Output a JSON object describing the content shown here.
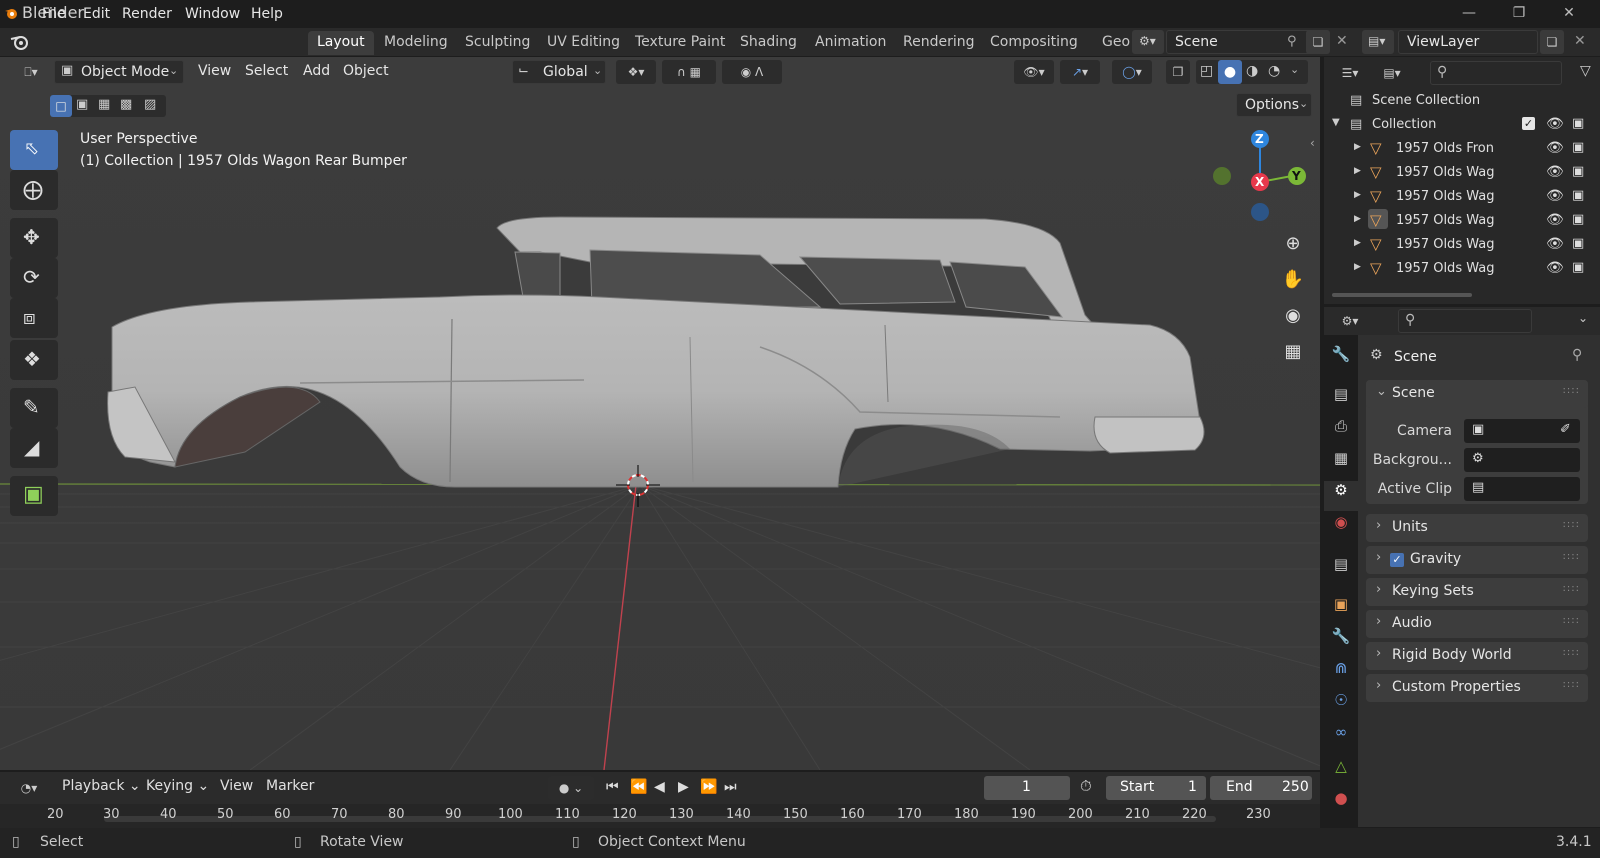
{
  "window": {
    "title": "Blender",
    "version": "3.4.1"
  },
  "menu": [
    "File",
    "Edit",
    "Render",
    "Window",
    "Help"
  ],
  "workspaces": [
    "Layout",
    "Modeling",
    "Sculpting",
    "UV Editing",
    "Texture Paint",
    "Shading",
    "Animation",
    "Rendering",
    "Compositing",
    "Geo"
  ],
  "active_workspace": "Layout",
  "scene_field": "Scene",
  "viewlayer_field": "ViewLayer",
  "viewport": {
    "mode": "Object Mode",
    "menus": [
      "View",
      "Select",
      "Add",
      "Object"
    ],
    "orientation": "Global",
    "options_label": "Options",
    "overlay_title": "User Perspective",
    "overlay_sub": "(1) Collection | 1957 Olds Wagon Rear Bumper",
    "gizmo": {
      "z": "Z",
      "x": "X",
      "y": "Y"
    }
  },
  "outliner": {
    "scene_collection": "Scene Collection",
    "collection": "Collection",
    "items": [
      "1957 Olds Fron",
      "1957 Olds Wag",
      "1957 Olds Wag",
      "1957 Olds Wag",
      "1957 Olds Wag",
      "1957 Olds Wag"
    ]
  },
  "properties": {
    "context": "Scene",
    "panel_scene": "Scene",
    "camera_label": "Camera",
    "background_label": "Backgrou...",
    "active_clip_label": "Active Clip",
    "panels": [
      "Units",
      "Gravity",
      "Keying Sets",
      "Audio",
      "Rigid Body World",
      "Custom Properties"
    ]
  },
  "timeline": {
    "menus": [
      "Playback",
      "Keying",
      "View",
      "Marker"
    ],
    "current_frame": "1",
    "start_label": "Start",
    "start": "1",
    "end_label": "End",
    "end": "250",
    "ruler": [
      "20",
      "30",
      "40",
      "50",
      "60",
      "70",
      "80",
      "90",
      "100",
      "110",
      "120",
      "130",
      "140",
      "150",
      "160",
      "170",
      "180",
      "190",
      "200",
      "210",
      "220",
      "230"
    ]
  },
  "status": {
    "select": "Select",
    "rotate": "Rotate View",
    "context": "Object Context Menu"
  },
  "colors": {
    "accent": "#4772b3",
    "x_axis": "#e8394c",
    "y_axis": "#7bb837",
    "z_axis": "#2e86de"
  }
}
